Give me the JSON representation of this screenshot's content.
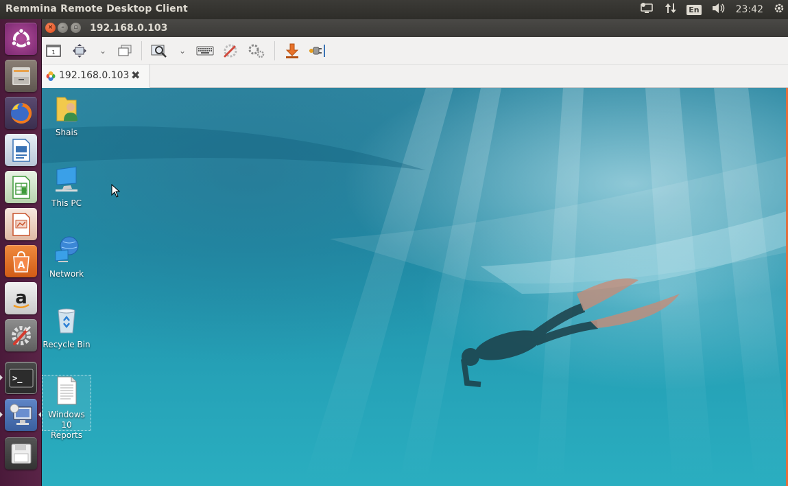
{
  "top_panel": {
    "app_title": "Remmina Remote Desktop Client",
    "input_language": "En",
    "clock": "23:42"
  },
  "launcher": {
    "items": [
      {
        "name": "ubuntu-dash"
      },
      {
        "name": "files"
      },
      {
        "name": "firefox"
      },
      {
        "name": "libreoffice-writer"
      },
      {
        "name": "libreoffice-calc"
      },
      {
        "name": "libreoffice-impress"
      },
      {
        "name": "ubuntu-software"
      },
      {
        "name": "amazon",
        "glyph": "a"
      },
      {
        "name": "system-settings"
      },
      {
        "name": "terminal",
        "glyph": ">_"
      },
      {
        "name": "remmina"
      },
      {
        "name": "floppy-drive"
      }
    ]
  },
  "window": {
    "title": "192.168.0.103"
  },
  "tabs": [
    {
      "label": "192.168.0.103"
    }
  ],
  "desktop": {
    "icons": [
      {
        "label": "Shais"
      },
      {
        "label": "This PC"
      },
      {
        "label": "Network"
      },
      {
        "label": "Recycle Bin"
      },
      {
        "label_line1": "Windows 10",
        "label_line2": "Reports"
      }
    ]
  },
  "colors": {
    "launcher_bg": "#5a2447",
    "panel_bg": "#3c3b37",
    "water": "#1f8ea8",
    "close_button": "#df4a16"
  }
}
